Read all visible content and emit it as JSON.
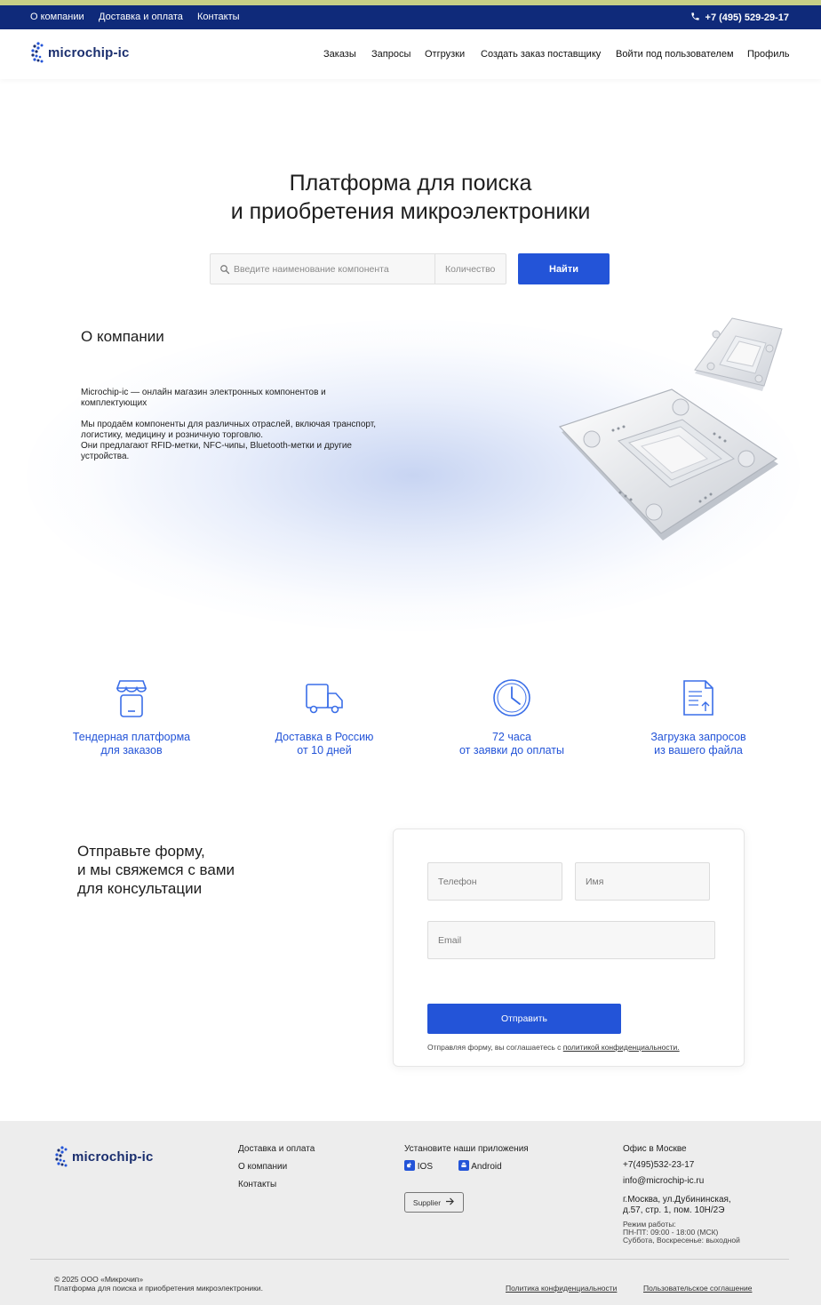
{
  "topbar": {
    "links": [
      "О компании",
      "Доставка и оплата",
      "Контакты"
    ],
    "phone": "+7 (495) 529-29-17"
  },
  "brand": {
    "name": "microchip-ic"
  },
  "nav": [
    "Заказы",
    "Запросы",
    "Отгрузки",
    "Создать заказ поставщику",
    "Войти под пользователем",
    "Профиль"
  ],
  "hero": {
    "title_line1": "Платформа для поиска",
    "title_line2": "и приобретения микроэлектроники",
    "search_placeholder": "Введите наименование компонента",
    "qty_placeholder": "Количество",
    "search_button": "Найти"
  },
  "about": {
    "title": "О компании",
    "p1": "Microchip-ic — онлайн магазин электронных компонентов и комплектующих",
    "p2_line1": "Мы продаём компоненты для различных отраслей, включая транспорт, логистику, медицину и розничную торговлю.",
    "p2_line2": "Они предлагают RFID-метки, NFC-чипы, Bluetooth-метки и другие устройства."
  },
  "features": [
    {
      "icon": "shop-icon",
      "line1": "Тендерная платформа",
      "line2": "для заказов"
    },
    {
      "icon": "truck-icon",
      "line1": "Доставка в Россию",
      "line2": "от 10 дней"
    },
    {
      "icon": "clock-icon",
      "line1": "72 часа",
      "line2": "от заявки до оплаты"
    },
    {
      "icon": "document-upload-icon",
      "line1": "Загрузка запросов",
      "line2": "из вашего файла"
    }
  ],
  "contact_form": {
    "title_line1": "Отправьте форму,",
    "title_line2": "и мы свяжемся с вами",
    "title_line3": "для консультации",
    "phone_placeholder": "Телефон",
    "name_placeholder": "Имя",
    "email_placeholder": "Email",
    "submit": "Отправить",
    "consent_text": "Отправляя форму, вы соглашаетесь с ",
    "consent_link": "политикой конфиденциальности."
  },
  "footer": {
    "links": [
      "Доставка и оплата",
      "О компании",
      "Контакты"
    ],
    "apps_title": "Установите наши приложения",
    "app_ios": "IOS",
    "app_android": "Android",
    "supplier_button": "Supplier",
    "office_title": "Офис в Москве",
    "office_phone": "+7(495)532-23-17",
    "office_email": "info@microchip-ic.ru",
    "address_line1": "г.Москва, ул.Дубининская,",
    "address_line2": "д.57, стр. 1, пом. 10Н/2Э",
    "hours_title": "Режим работы:",
    "hours_weekdays": "ПН-ПТ: 09:00 - 18:00 (МСК)",
    "hours_weekend": "Суббота, Воскресенье: выходной",
    "copyright": "© 2025 ООО «Микрочип»",
    "tagline": "Платформа для поиска и приобретения микроэлектроники.",
    "privacy_link": "Политика конфиденциальности",
    "terms_link": "Пользовательское соглашение"
  },
  "colors": {
    "topbar": "#0f2a7a",
    "accent_strip": "#c7cf86",
    "primary": "#2354d8",
    "brand_text": "#1a2e6e",
    "footer_bg": "#ededed"
  }
}
